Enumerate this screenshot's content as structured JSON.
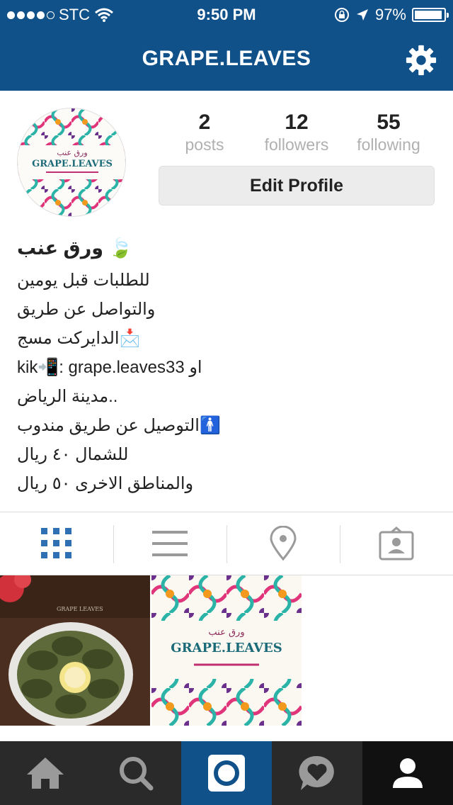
{
  "status_bar": {
    "carrier": "STC",
    "time": "9:50 PM",
    "battery": "97%"
  },
  "nav": {
    "title": "GRAPE.LEAVES"
  },
  "profile": {
    "avatar_text_ar": "ورق عنب",
    "avatar_text_en": "GRAPE.LEAVES",
    "stats": [
      {
        "value": "2",
        "label": "posts"
      },
      {
        "value": "12",
        "label": "followers"
      },
      {
        "value": "55",
        "label": "following"
      }
    ],
    "edit_button": "Edit Profile"
  },
  "bio": {
    "name": "ورق عنب 🍃",
    "lines": [
      "للطلبات قبل يومين",
      "والتواصل عن طريق",
      "الدايركت مسج📩",
      "kik📲: grape.leaves33 او",
      "مدينة الرياض..",
      "التوصيل عن طريق مندوب🚹",
      "للشمال ٤٠ ريال",
      "والمناطق الاخرى ٥٠ ريال"
    ]
  },
  "view_tabs": [
    {
      "icon": "grid-icon",
      "active": true
    },
    {
      "icon": "list-icon",
      "active": false
    },
    {
      "icon": "location-pin-icon",
      "active": false
    },
    {
      "icon": "tagged-photos-icon",
      "active": false
    }
  ],
  "posts": [
    {
      "icon": "food-photo",
      "caption": "GRAPE LEAVES"
    },
    {
      "icon": "logo-tile-photo",
      "text_ar": "ورق عنب",
      "text_en": "GRAPE.LEAVES"
    }
  ],
  "tab_bar": [
    {
      "icon": "home-icon"
    },
    {
      "icon": "search-icon"
    },
    {
      "icon": "camera-icon",
      "active": true
    },
    {
      "icon": "activity-heart-icon"
    },
    {
      "icon": "profile-icon",
      "selected": true
    }
  ],
  "colors": {
    "brand": "#11518a",
    "tabbar": "#2a2a2a",
    "active_tab_icon": "#2f6fb3",
    "inactive_icon": "#9a9a9a"
  }
}
